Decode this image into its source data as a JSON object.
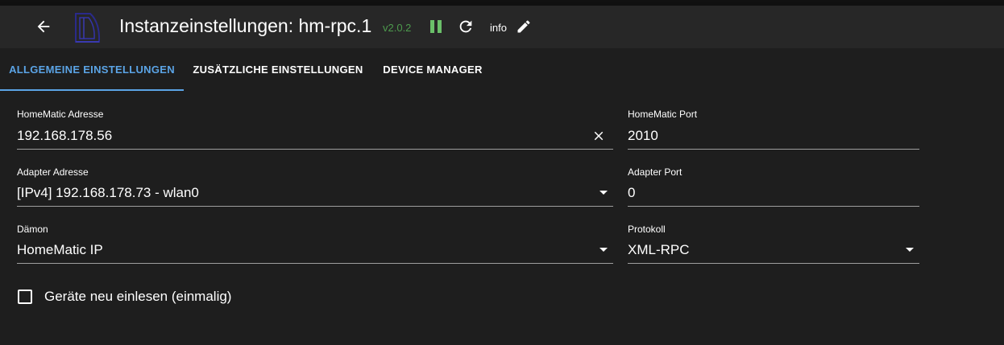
{
  "header": {
    "title": "Instanzeinstellungen: hm-rpc.1",
    "version": "v2.0.2",
    "info_label": "info",
    "colors": {
      "version": "#4d9a4d",
      "pause": "#6abf69",
      "accent": "#5ba4e6"
    },
    "icons": [
      "arrow-left-icon",
      "adapter-logo-icon",
      "pause-icon",
      "reload-icon",
      "pencil-icon"
    ]
  },
  "tabs": [
    {
      "label": "ALLGEMEINE EINSTELLUNGEN",
      "active": true
    },
    {
      "label": "ZUSÄTZLICHE EINSTELLUNGEN",
      "active": false
    },
    {
      "label": "DEVICE MANAGER",
      "active": false
    }
  ],
  "form": {
    "homematic_address": {
      "label": "HomeMatic Adresse",
      "value": "192.168.178.56"
    },
    "homematic_port": {
      "label": "HomeMatic Port",
      "value": "2010"
    },
    "adapter_address": {
      "label": "Adapter Adresse",
      "value": "[IPv4] 192.168.178.73 - wlan0"
    },
    "adapter_port": {
      "label": "Adapter Port",
      "value": "0"
    },
    "daemon": {
      "label": "Dämon",
      "value": "HomeMatic IP"
    },
    "protocol": {
      "label": "Protokoll",
      "value": "XML-RPC"
    },
    "reread_devices": {
      "label": "Geräte neu einlesen (einmalig)",
      "checked": false
    }
  }
}
